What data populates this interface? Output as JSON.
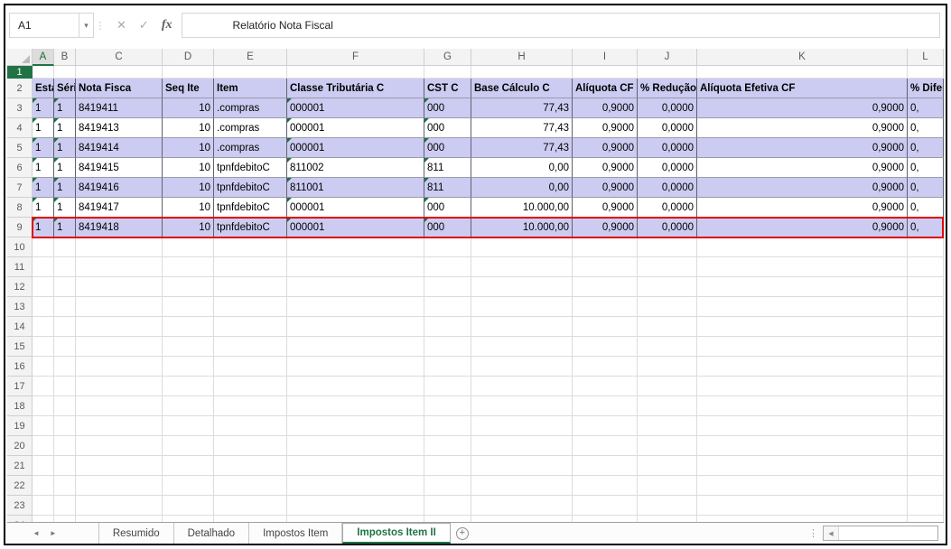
{
  "formula_bar": {
    "cell_ref": "A1",
    "content": "Relatório Nota Fiscal"
  },
  "icons": {
    "name_box_dropdown": "▾",
    "drag_handle": "⋮",
    "cancel": "✕",
    "enter": "✓",
    "insert_function": "fx",
    "nav_left": "◄",
    "nav_right": "►",
    "add_sheet": "+",
    "scroll_left": "◀",
    "scroll_dots": "⋮"
  },
  "grid": {
    "column_letters": [
      "A",
      "B",
      "C",
      "D",
      "E",
      "F",
      "G",
      "H",
      "I",
      "J",
      "K",
      "L"
    ],
    "selected_column": "A",
    "selected_row": 1,
    "visible_row_count": 24,
    "header_row_index": 2,
    "header_row": [
      "Esta",
      "Séri",
      "Nota Fisca",
      "Seq Ite",
      "Item",
      "Classe Tributária C",
      "CST C",
      "Base Cálculo C",
      "Alíquota CF",
      "% Redução",
      "Alíquota Efetiva CF",
      "% Diferimen"
    ],
    "first_data_row_index": 3,
    "data_rows": [
      [
        "1",
        "1",
        "8419411",
        "10",
        ".compras",
        "000001",
        "000",
        "77,43",
        "0,9000",
        "0,0000",
        "0,9000",
        "0,"
      ],
      [
        "1",
        "1",
        "8419413",
        "10",
        ".compras",
        "000001",
        "000",
        "77,43",
        "0,9000",
        "0,0000",
        "0,9000",
        "0,"
      ],
      [
        "1",
        "1",
        "8419414",
        "10",
        ".compras",
        "000001",
        "000",
        "77,43",
        "0,9000",
        "0,0000",
        "0,9000",
        "0,"
      ],
      [
        "1",
        "1",
        "8419415",
        "10",
        "tpnfdebitoC",
        "811002",
        "811",
        "0,00",
        "0,9000",
        "0,0000",
        "0,9000",
        "0,"
      ],
      [
        "1",
        "1",
        "8419416",
        "10",
        "tpnfdebitoC",
        "811001",
        "811",
        "0,00",
        "0,9000",
        "0,0000",
        "0,9000",
        "0,"
      ],
      [
        "1",
        "1",
        "8419417",
        "10",
        "tpnfdebitoC",
        "000001",
        "000",
        "10.000,00",
        "0,9000",
        "0,0000",
        "0,9000",
        "0,"
      ],
      [
        "1",
        "1",
        "8419418",
        "10",
        "tpnfdebitoC",
        "000001",
        "000",
        "10.000,00",
        "0,9000",
        "0,0000",
        "0,9000",
        "0,"
      ]
    ],
    "banded_row_indices": [
      2,
      3,
      5,
      7,
      9
    ],
    "highlighted_row_index": 9,
    "error_marker_columns": [
      0,
      1,
      5,
      6
    ],
    "colors": {
      "accent_green": "#217346",
      "band_lavender": "#ccccf2",
      "highlight_red": "#e10000"
    }
  },
  "sheet_bar": {
    "tabs": [
      {
        "label": "Resumido",
        "active": false
      },
      {
        "label": "Detalhado",
        "active": false
      },
      {
        "label": "Impostos Item",
        "active": false
      },
      {
        "label": "Impostos Item II",
        "active": true
      }
    ]
  }
}
